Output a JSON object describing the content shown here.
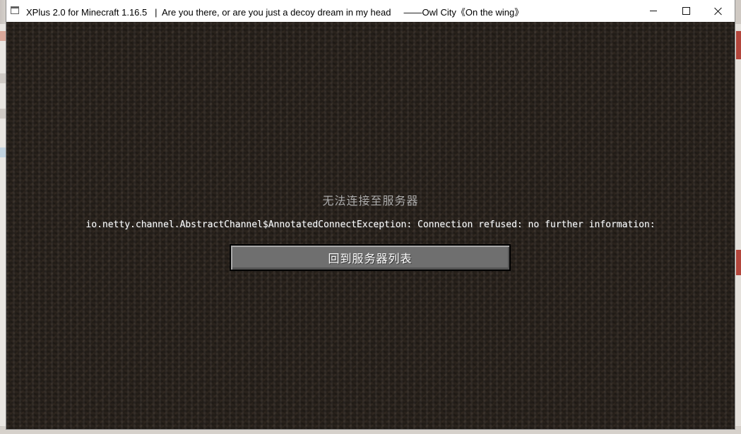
{
  "window": {
    "title": "XPlus 2.0 for Minecraft 1.16.5   |  Are you there, or are you just a decoy dream in my head     ——Owl City《On the wing》",
    "controls": {
      "minimize_icon": "minimize-icon",
      "maximize_icon": "maximize-icon",
      "close_icon": "close-icon"
    }
  },
  "screen": {
    "title": "无法连接至服务器",
    "reason": "io.netty.channel.AbstractChannel$AnnotatedConnectException: Connection refused: no further information:",
    "back_button_label": "回到服务器列表"
  },
  "colors": {
    "title_text": "#aaaaaa",
    "reason_text": "#ffffff",
    "button_face": "#6f6f6f",
    "background_dirt": "#2a231d"
  }
}
